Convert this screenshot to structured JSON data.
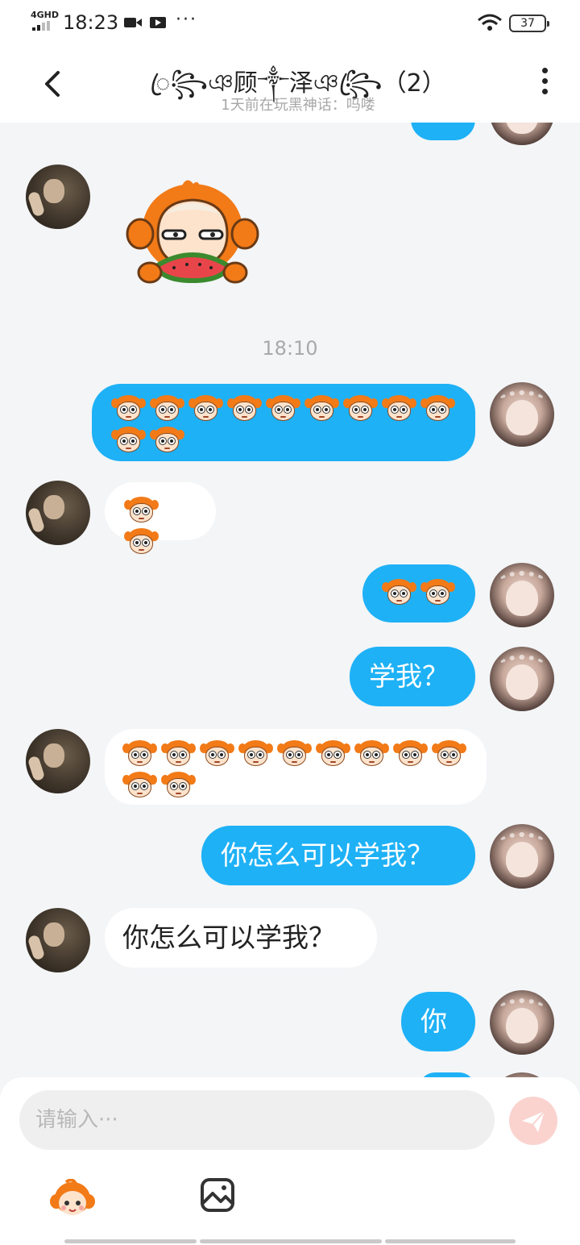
{
  "status_bar": {
    "network": "4GHD",
    "time": "18:23",
    "more": "···",
    "battery": "37"
  },
  "header": {
    "title": "ꦿ꧂ঞ顾༒泽ঞ꧂ꦿ（2）",
    "subtitle": "1天前在玩黑神话：吗喽"
  },
  "chat": {
    "timestamp": "18:10",
    "messages": [
      {
        "side": "in",
        "kind": "sticker"
      },
      {
        "side": "out",
        "kind": "emoji",
        "count": 11
      },
      {
        "side": "in",
        "kind": "emoji",
        "count": 2
      },
      {
        "side": "out",
        "kind": "emoji",
        "count": 2
      },
      {
        "side": "out",
        "kind": "text",
        "text": "学我？"
      },
      {
        "side": "in",
        "kind": "emoji",
        "count": 11
      },
      {
        "side": "out",
        "kind": "text",
        "text": "你怎么可以学我？"
      },
      {
        "side": "in",
        "kind": "text",
        "text": "你怎么可以学我？"
      },
      {
        "side": "out",
        "kind": "text",
        "text": "你"
      }
    ]
  },
  "input": {
    "placeholder": "请输入···"
  },
  "icons": {
    "back": "chevron-left-icon",
    "more": "more-vertical-icon",
    "send": "send-icon",
    "emoji": "emoji-face-icon",
    "image": "image-icon"
  },
  "colors": {
    "outgoing_bubble": "#1eb1f6",
    "incoming_bubble": "#ffffff",
    "send_button": "#fad3cf",
    "emoji_orange": "#f27a17"
  }
}
